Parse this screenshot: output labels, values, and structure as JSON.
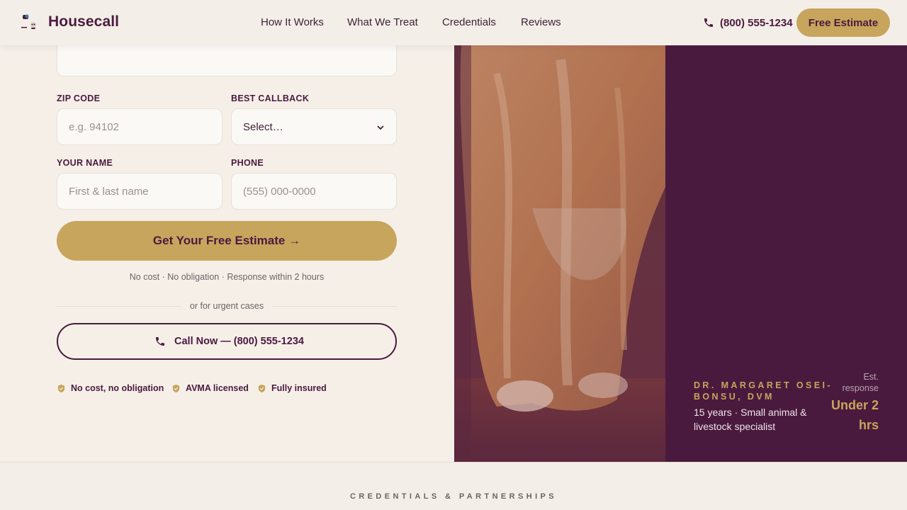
{
  "brand": {
    "name": "Housecall",
    "logo_icon": "pet-logo-icon"
  },
  "nav": {
    "items": [
      "How It Works",
      "What We Treat",
      "Credentials",
      "Reviews"
    ]
  },
  "header": {
    "phone": "(800) 555-1234",
    "phone_icon": "phone-icon",
    "cta_label": "Free Estimate"
  },
  "form": {
    "zip": {
      "label": "ZIP CODE",
      "placeholder": "e.g. 94102"
    },
    "callback": {
      "label": "BEST CALLBACK",
      "value": "Select…"
    },
    "name": {
      "label": "YOUR NAME",
      "placeholder": "First & last name"
    },
    "phone": {
      "label": "PHONE",
      "placeholder": "(555) 000-0000"
    },
    "submit_label": "Get Your Free Estimate →",
    "note": "No cost · No obligation · Response within 2 hours",
    "divider": "or for urgent cases",
    "call_label": "Call Now — (800) 555-1234"
  },
  "trust": [
    "No cost, no obligation",
    "AVMA licensed",
    "Fully insured"
  ],
  "hero": {
    "vet_name": "DR. MARGARET OSEI-BONSU, DVM",
    "vet_desc": "15 years · Small animal & livestock specialist",
    "response_label": "Est. response",
    "response_value": "Under 2 hrs"
  },
  "bottom": {
    "label": "CREDENTIALS & PARTNERSHIPS"
  },
  "colors": {
    "brand": "#4a1a3e",
    "accent": "#c7a55c",
    "background": "#f5efe8"
  }
}
